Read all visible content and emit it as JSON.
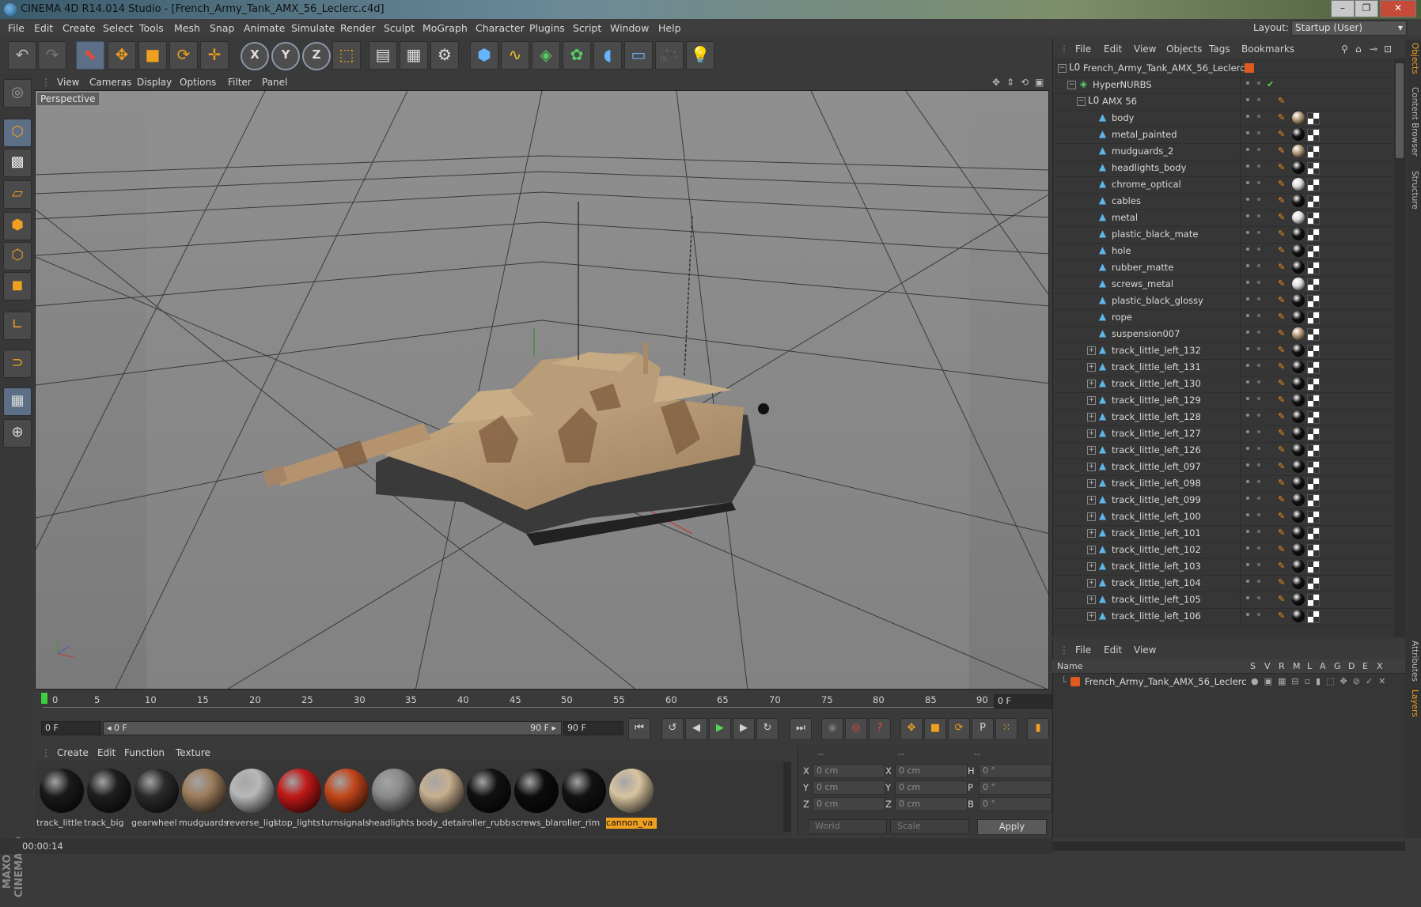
{
  "window": {
    "title": "CINEMA 4D R14.014 Studio - [French_Army_Tank_AMX_56_Leclerc.c4d]",
    "controls": [
      "–",
      "❐",
      "✕"
    ]
  },
  "menubar": {
    "items": [
      "File",
      "Edit",
      "Create",
      "Select",
      "Tools",
      "Mesh",
      "Snap",
      "Animate",
      "Simulate",
      "Render",
      "Sculpt",
      "MoGraph",
      "Character",
      "Plugins",
      "Script",
      "Window",
      "Help"
    ],
    "layout_label": "Layout:",
    "layout_value": "Startup (User)"
  },
  "viewport": {
    "menu": [
      "View",
      "Cameras",
      "Display",
      "Options",
      "Filter",
      "Panel"
    ],
    "label": "Perspective"
  },
  "timeline": {
    "ticks": [
      "0",
      "5",
      "10",
      "15",
      "20",
      "25",
      "30",
      "35",
      "40",
      "45",
      "50",
      "55",
      "60",
      "65",
      "70",
      "75",
      "80",
      "85",
      "90"
    ],
    "current_frame": "0 F",
    "start_field": "0 F",
    "range_start": "◂ 0 F",
    "range_end": "90 F ▸",
    "end_field": "90 F"
  },
  "materials": {
    "menu": [
      "Create",
      "Edit",
      "Function",
      "Texture"
    ],
    "items": [
      {
        "label": "track_little",
        "color": "#1a1a1a"
      },
      {
        "label": "track_big",
        "color": "#1e1e1e"
      },
      {
        "label": "gearwheel",
        "color": "#2a2a2a"
      },
      {
        "label": "mudguards",
        "color": "#9c7d5c"
      },
      {
        "label": "reverse_ligl",
        "color": "#b8b8b8"
      },
      {
        "label": "stop_lights",
        "color": "#c01818"
      },
      {
        "label": "turnsignals",
        "color": "#c2461a"
      },
      {
        "label": "headlights",
        "color": "#8a8a8a"
      },
      {
        "label": "body_detai",
        "color": "#c8b090"
      },
      {
        "label": "roller_rubb",
        "color": "#111111"
      },
      {
        "label": "screws_bla",
        "color": "#0c0c0c"
      },
      {
        "label": "roller_rim",
        "color": "#121212"
      },
      {
        "label": "cannon_va",
        "color": "#d8c4a0"
      }
    ]
  },
  "coords": {
    "header": [
      "--",
      "--",
      "--"
    ],
    "rows": [
      {
        "l1": "X",
        "v1": "0 cm",
        "l2": "X",
        "v2": "0 cm",
        "l3": "H",
        "v3": "0 °"
      },
      {
        "l1": "Y",
        "v1": "0 cm",
        "l2": "Y",
        "v2": "0 cm",
        "l3": "P",
        "v3": "0 °"
      },
      {
        "l1": "Z",
        "v1": "0 cm",
        "l2": "Z",
        "v2": "0 cm",
        "l3": "B",
        "v3": "0 °"
      }
    ],
    "mode1": "World",
    "mode2": "Scale",
    "apply": "Apply"
  },
  "status": {
    "time": "00:00:14"
  },
  "object_manager": {
    "menu": [
      "File",
      "Edit",
      "View",
      "Objects",
      "Tags",
      "Bookmarks"
    ],
    "root": "French_Army_Tank_AMX_56_Leclerc",
    "hypernurbs": "HyperNURBS",
    "group": "AMX 56",
    "children": [
      {
        "name": "body",
        "mat": "#b59a78"
      },
      {
        "name": "metal_painted",
        "mat": "#111"
      },
      {
        "name": "mudguards_2",
        "mat": "#b59a78"
      },
      {
        "name": "headlights_body",
        "mat": "#111"
      },
      {
        "name": "chrome_optical",
        "mat": "#ddd"
      },
      {
        "name": "cables",
        "mat": "#111"
      },
      {
        "name": "metal",
        "mat": "#ddd"
      },
      {
        "name": "plastic_black_mate",
        "mat": "#111"
      },
      {
        "name": "hole",
        "mat": "#111"
      },
      {
        "name": "rubber_matte",
        "mat": "#111"
      },
      {
        "name": "screws_metal",
        "mat": "#ddd"
      },
      {
        "name": "plastic_black_glossy",
        "mat": "#111"
      },
      {
        "name": "rope",
        "mat": "#111"
      },
      {
        "name": "suspension007",
        "mat": "#b59a78"
      },
      {
        "name": "track_little_left_132",
        "mat": "#111"
      },
      {
        "name": "track_little_left_131",
        "mat": "#111"
      },
      {
        "name": "track_little_left_130",
        "mat": "#111"
      },
      {
        "name": "track_little_left_129",
        "mat": "#111"
      },
      {
        "name": "track_little_left_128",
        "mat": "#111"
      },
      {
        "name": "track_little_left_127",
        "mat": "#111"
      },
      {
        "name": "track_little_left_126",
        "mat": "#111"
      },
      {
        "name": "track_little_left_097",
        "mat": "#111"
      },
      {
        "name": "track_little_left_098",
        "mat": "#111"
      },
      {
        "name": "track_little_left_099",
        "mat": "#111"
      },
      {
        "name": "track_little_left_100",
        "mat": "#111"
      },
      {
        "name": "track_little_left_101",
        "mat": "#111"
      },
      {
        "name": "track_little_left_102",
        "mat": "#111"
      },
      {
        "name": "track_little_left_103",
        "mat": "#111"
      },
      {
        "name": "track_little_left_104",
        "mat": "#111"
      },
      {
        "name": "track_little_left_105",
        "mat": "#111"
      },
      {
        "name": "track_little_left_106",
        "mat": "#111"
      }
    ]
  },
  "side_tabs": [
    "Objects",
    "Content Browser",
    "Structure",
    "Attributes",
    "Layers"
  ],
  "layer_manager": {
    "menu": [
      "File",
      "Edit",
      "View"
    ],
    "columns": [
      "Name",
      "S",
      "V",
      "R",
      "M",
      "L",
      "A",
      "G",
      "D",
      "E",
      "X"
    ],
    "row": "French_Army_Tank_AMX_56_Leclerc"
  }
}
